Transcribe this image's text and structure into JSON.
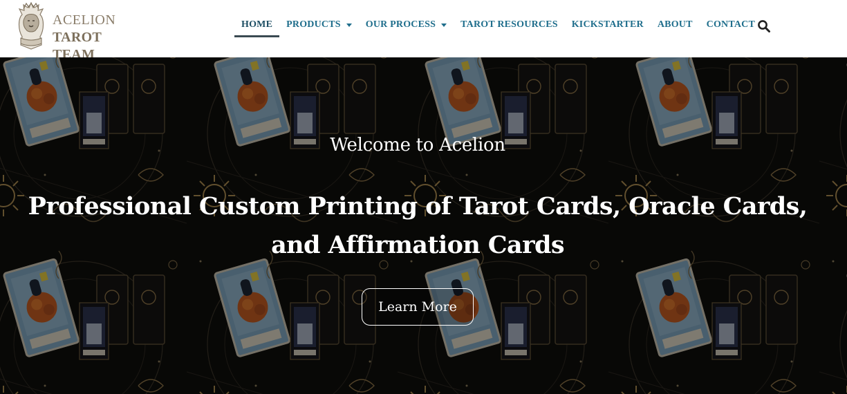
{
  "brand": {
    "line1": "ACELION",
    "line2": "TAROT TEAM",
    "emblem_icon": "lion-crest-icon"
  },
  "nav": {
    "items": [
      {
        "label": "HOME",
        "active": true,
        "dropdown": false
      },
      {
        "label": "PRODUCTS",
        "active": false,
        "dropdown": true
      },
      {
        "label": "OUR PROCESS",
        "active": false,
        "dropdown": true
      },
      {
        "label": "TAROT RESOURCES",
        "active": false,
        "dropdown": false
      },
      {
        "label": "KICKSTARTER",
        "active": false,
        "dropdown": false
      },
      {
        "label": "ABOUT",
        "active": false,
        "dropdown": false
      },
      {
        "label": "CONTACT",
        "active": false,
        "dropdown": false
      }
    ],
    "search_icon": "search-icon"
  },
  "hero": {
    "subtitle": "Welcome to Acelion",
    "title": "Professional Custom Printing of Tarot Cards, Oracle Cards, and Affirmation Cards",
    "button_label": "Learn More",
    "background": "tarot-card-pattern"
  },
  "colors": {
    "nav_text": "#1f6e8c",
    "brand_text": "#8a7d6a",
    "hero_text": "#ffffff",
    "gold": "#b8945a"
  }
}
